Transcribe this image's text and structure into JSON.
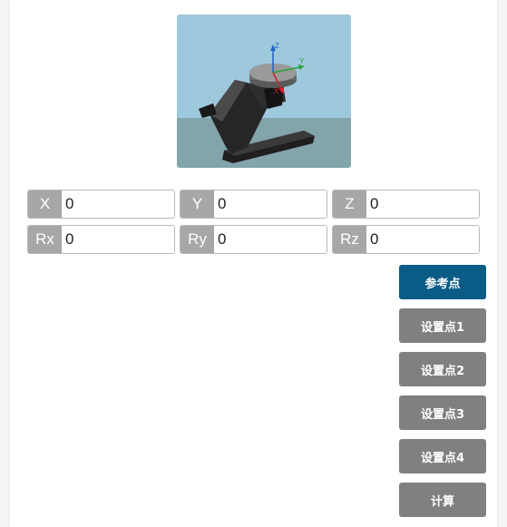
{
  "preview": {
    "axes": {
      "x": "X",
      "y": "Y",
      "z": "Z"
    },
    "colors": {
      "sky": "#9ec8dc",
      "ground": "#82a4ab",
      "x_axis": "#d0202a",
      "y_axis": "#2aa33a",
      "z_axis": "#1f63c4"
    }
  },
  "coords": {
    "x": {
      "label": "X",
      "value": "0"
    },
    "y": {
      "label": "Y",
      "value": "0"
    },
    "z": {
      "label": "Z",
      "value": "0"
    },
    "rx": {
      "label": "Rx",
      "value": "0"
    },
    "ry": {
      "label": "Ry",
      "value": "0"
    },
    "rz": {
      "label": "Rz",
      "value": "0"
    }
  },
  "buttons": {
    "reference": "参考点",
    "set1": "设置点1",
    "set2": "设置点2",
    "set3": "设置点3",
    "set4": "设置点4",
    "compute": "计算"
  },
  "colors": {
    "primary": "#0a5c86",
    "secondary": "#808080",
    "label_bg": "#a7a7a7"
  }
}
